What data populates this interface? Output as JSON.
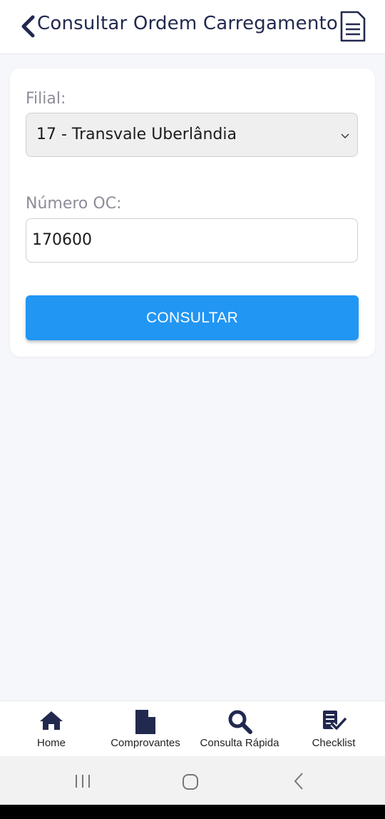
{
  "header": {
    "title": "Consultar Ordem Carregamento"
  },
  "form": {
    "filial_label": "Filial:",
    "filial_value": "17 - Transvale Uberlândia",
    "numero_label": "Número OC:",
    "numero_value": "170600",
    "submit_label": "CONSULTAR"
  },
  "tabs": [
    {
      "label": "Home",
      "icon": "home-icon"
    },
    {
      "label": "Comprovantes",
      "icon": "document-icon"
    },
    {
      "label": "Consulta Rápida",
      "icon": "search-icon"
    },
    {
      "label": "Checklist",
      "icon": "checklist-icon"
    }
  ],
  "colors": {
    "primary": "#2196f3",
    "navy": "#22294f",
    "background": "#f6f7fb"
  }
}
